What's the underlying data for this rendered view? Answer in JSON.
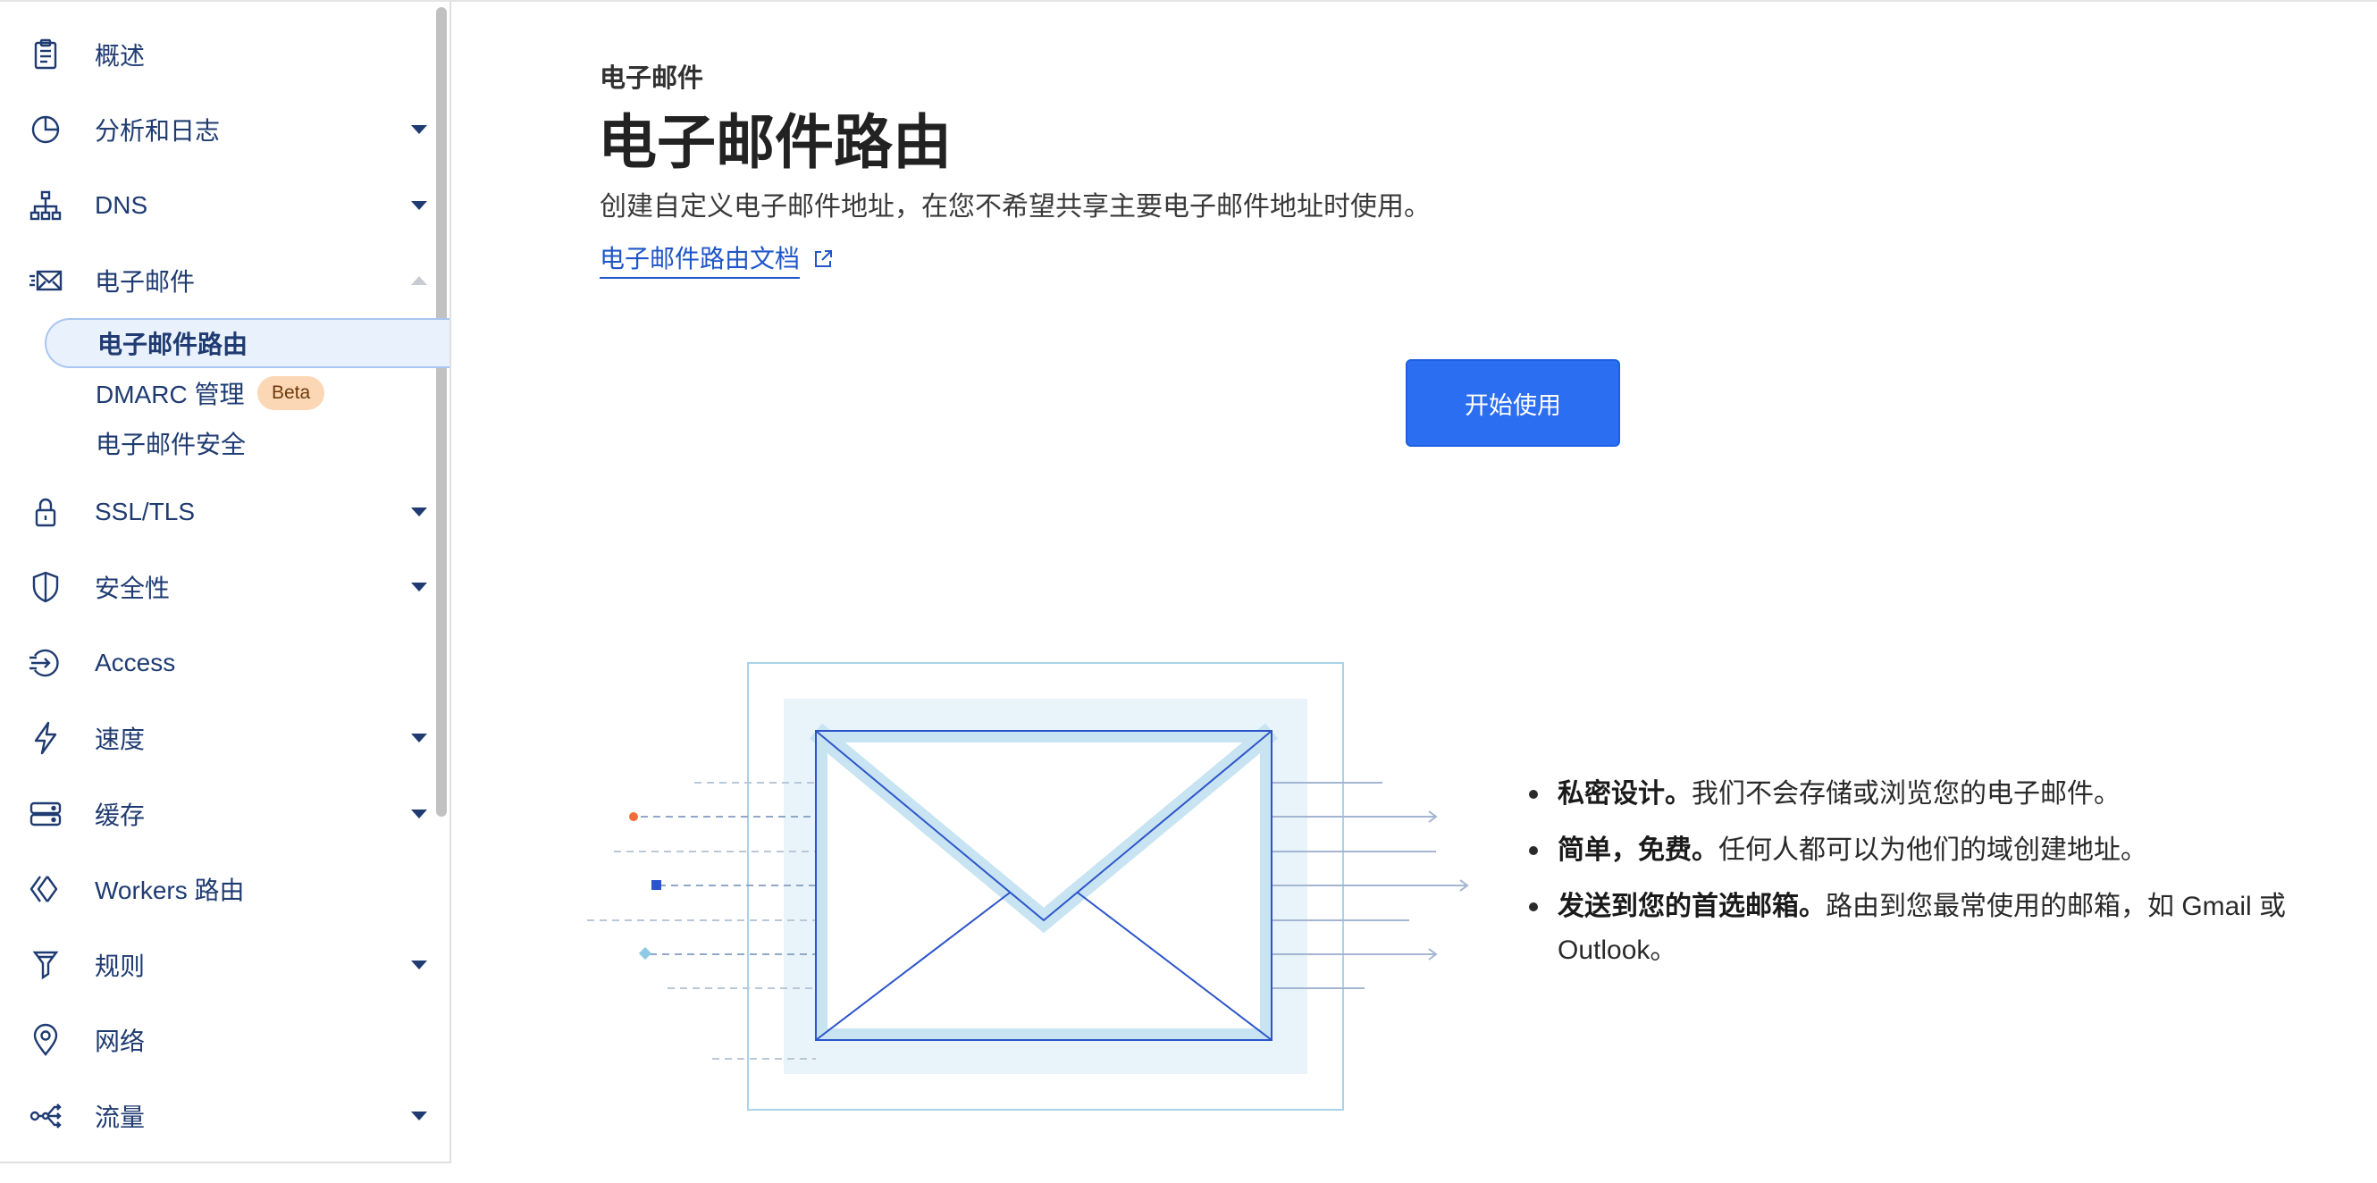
{
  "sidebar": {
    "items": [
      {
        "label": "概述",
        "icon": "clipboard-icon"
      },
      {
        "label": "分析和日志",
        "icon": "pie-chart-icon"
      },
      {
        "label": "DNS",
        "icon": "network-icon"
      },
      {
        "label": "电子邮件",
        "icon": "email-icon"
      },
      {
        "label": "SSL/TLS",
        "icon": "lock-icon"
      },
      {
        "label": "安全性",
        "icon": "shield-icon"
      },
      {
        "label": "Access",
        "icon": "access-icon"
      },
      {
        "label": "速度",
        "icon": "lightning-icon"
      },
      {
        "label": "缓存",
        "icon": "server-icon"
      },
      {
        "label": "Workers 路由",
        "icon": "workers-icon"
      },
      {
        "label": "规则",
        "icon": "funnel-icon"
      },
      {
        "label": "网络",
        "icon": "location-pin-icon"
      },
      {
        "label": "流量",
        "icon": "traffic-icon"
      }
    ],
    "email_subitems": [
      {
        "label": "电子邮件路由",
        "active": true
      },
      {
        "label": "DMARC 管理",
        "badge": "Beta"
      },
      {
        "label": "电子邮件安全"
      }
    ]
  },
  "main": {
    "eyebrow": "电子邮件",
    "title": "电子邮件路由",
    "description": "创建自定义电子邮件地址，在您不希望共享主要电子邮件地址时使用。",
    "doc_link": "电子邮件路由文档",
    "cta": "开始使用",
    "bullets": [
      {
        "bold": "私密设计。",
        "text": "我们不会存储或浏览您的电子邮件。"
      },
      {
        "bold": "简单，免费。",
        "text": "任何人都可以为他们的域创建地址。"
      },
      {
        "bold": "发送到您的首选邮箱。",
        "text": "路由到您最常使用的邮箱，如 Gmail 或 Outlook。"
      }
    ]
  },
  "colors": {
    "accent": "#2c6ef2",
    "nav_text": "#1f3b71",
    "link": "#1f56c9",
    "active_bg": "#e9f1fc",
    "beta_bg": "#fbd7b5"
  }
}
